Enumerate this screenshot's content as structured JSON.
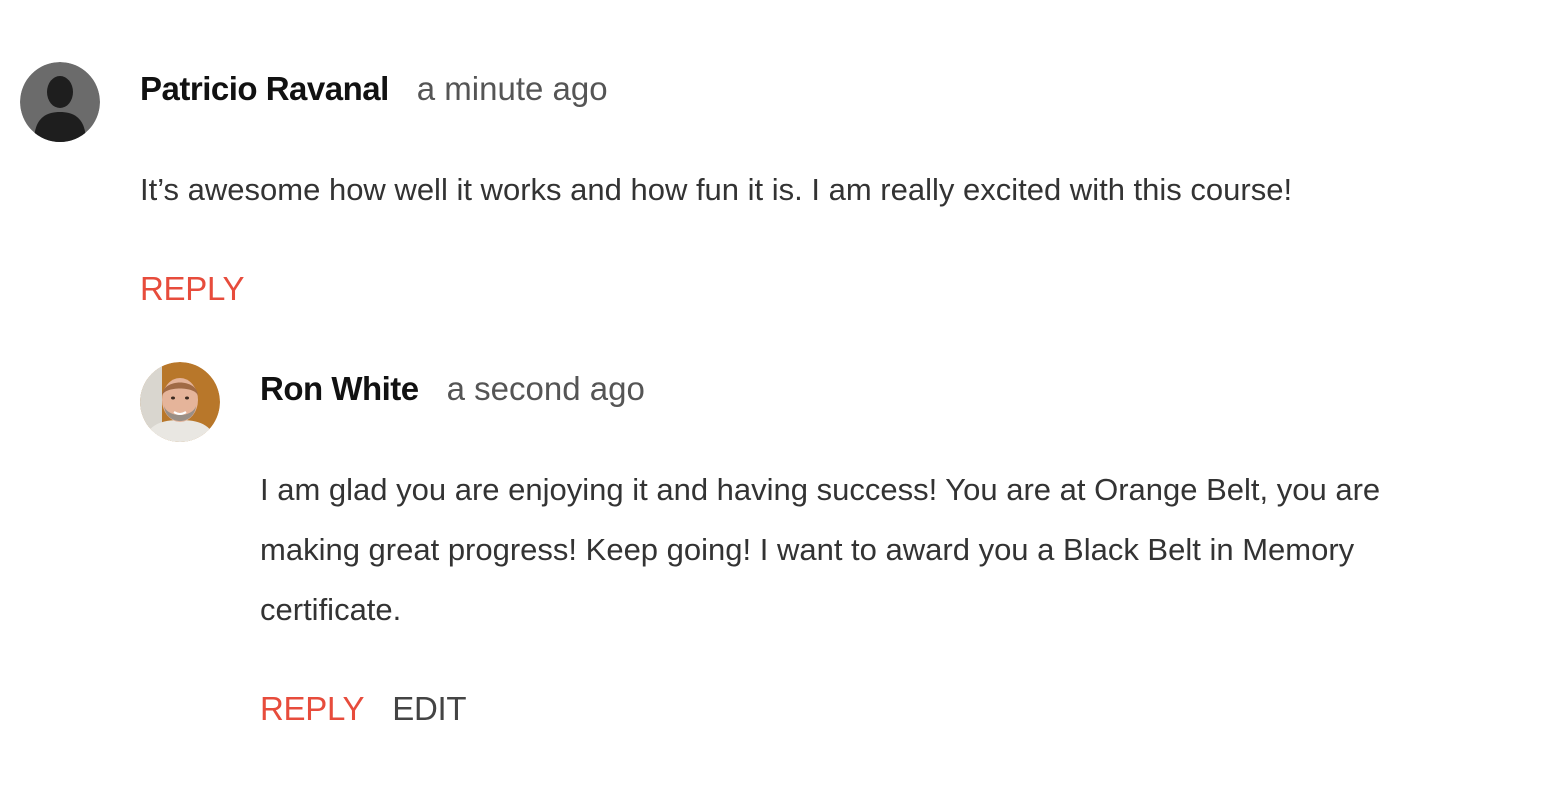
{
  "colors": {
    "accent": "#e74c3c",
    "text": "#333333",
    "author": "#111111",
    "muted": "#555555",
    "edit": "#444444"
  },
  "comments": [
    {
      "avatar_icon": "default-user-silhouette-icon",
      "author": "Patricio Ravanal",
      "time": "a minute ago",
      "body": "It’s awesome how well it works and how fun it is. I am really excited with this course!",
      "actions": {
        "reply": "REPLY"
      },
      "replies": [
        {
          "avatar_icon": "user-photo-avatar",
          "author": "Ron White",
          "time": "a second ago",
          "body": "I am glad you are enjoying it and having success! You are at Orange Belt, you are making great progress! Keep going! I want to award you a Black Belt in Memory certificate.",
          "actions": {
            "reply": "REPLY",
            "edit": "EDIT"
          }
        }
      ]
    }
  ]
}
